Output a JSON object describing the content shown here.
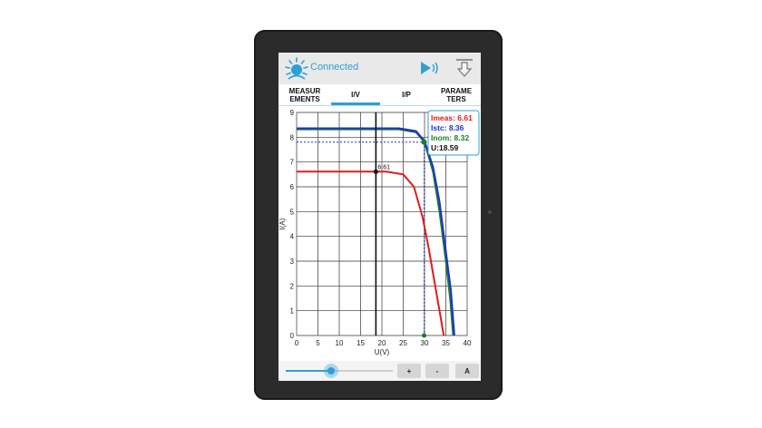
{
  "header": {
    "status": "Connected",
    "icons": [
      "sun-logo-icon",
      "play-signal-icon",
      "download-icon"
    ],
    "accent": "#2ea0d6"
  },
  "tabs": [
    {
      "label": "MEASUR EMENTS"
    },
    {
      "label": "I/V",
      "active": true
    },
    {
      "label": "I/P"
    },
    {
      "label": "PARAME TERS"
    }
  ],
  "chart_data": {
    "type": "line",
    "xlabel": "U(V)",
    "ylabel": "I(A)",
    "xlim": [
      0,
      40
    ],
    "ylim": [
      0,
      9
    ],
    "xticks": [
      0,
      5,
      10,
      15,
      20,
      25,
      30,
      35,
      40
    ],
    "yticks": [
      0,
      1,
      2,
      3,
      4,
      5,
      6,
      7,
      8,
      9
    ],
    "grid": true,
    "series": [
      {
        "color": "#1a7f24",
        "points": [
          [
            0,
            8.32
          ],
          [
            24,
            8.32
          ],
          [
            28,
            8.2
          ],
          [
            30,
            7.8
          ],
          [
            32,
            6.6
          ],
          [
            33.5,
            5
          ],
          [
            35,
            3
          ],
          [
            36,
            1.5
          ],
          [
            36.7,
            0
          ]
        ]
      },
      {
        "color": "#1e2fd6",
        "points": [
          [
            0,
            8.36
          ],
          [
            24,
            8.36
          ],
          [
            28,
            8.25
          ],
          [
            30,
            7.85
          ],
          [
            32,
            6.8
          ],
          [
            33.5,
            5.4
          ],
          [
            35,
            3.4
          ],
          [
            36.2,
            1.8
          ],
          [
            37,
            0
          ]
        ]
      },
      {
        "color": "#e01b1b",
        "points": [
          [
            0,
            6.61
          ],
          [
            21,
            6.61
          ],
          [
            25,
            6.5
          ],
          [
            27.5,
            6.0
          ],
          [
            29.5,
            4.8
          ],
          [
            31,
            3.5
          ],
          [
            32,
            2.5
          ],
          [
            33.5,
            1.0
          ],
          [
            34.5,
            0
          ]
        ]
      }
    ],
    "cursor": {
      "x": 18.59,
      "label": "6.61"
    },
    "marker": {
      "x": 29.9,
      "y": 7.8,
      "label": "7"
    },
    "hline": {
      "y": 7.8
    },
    "readout": [
      {
        "label": "Imeas",
        "value": "6.61",
        "color": "#e01b1b"
      },
      {
        "label": "Istc",
        "value": "8.36",
        "color": "#1e2fd6"
      },
      {
        "label": "Inom",
        "value": "8.32",
        "color": "#1a7f24"
      },
      {
        "label": "U",
        "value": "18.59",
        "color": "#111111"
      }
    ]
  },
  "bottom": {
    "slider_value": 0.42,
    "buttons": [
      "+",
      "-",
      "A"
    ]
  }
}
